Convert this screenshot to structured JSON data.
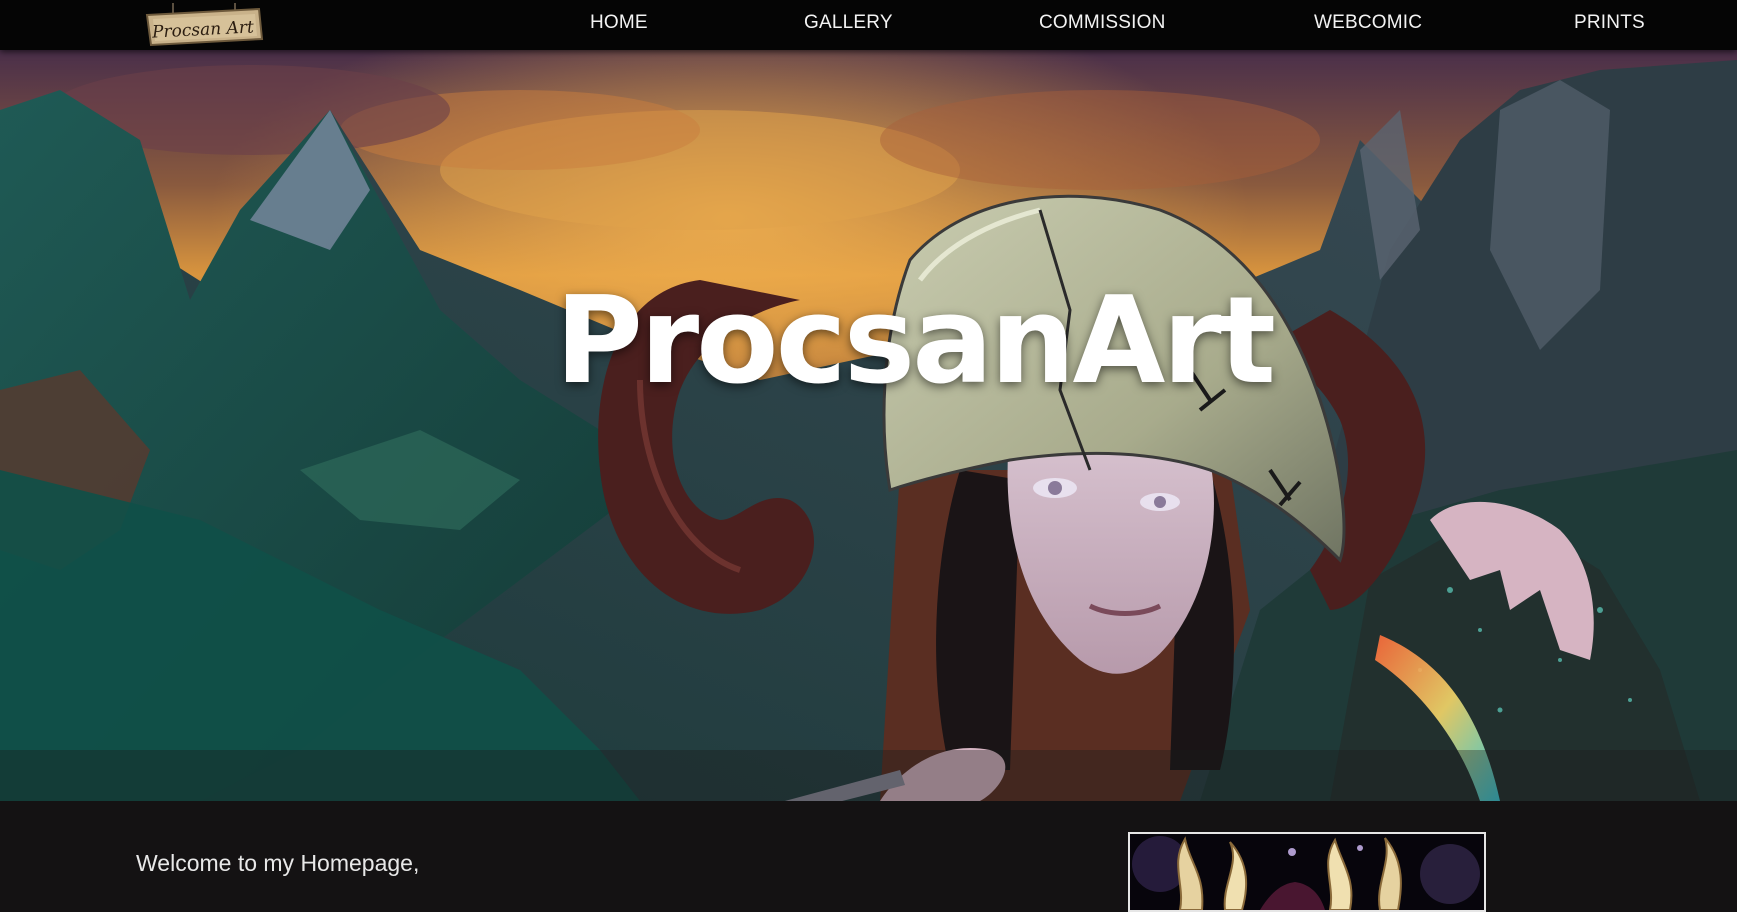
{
  "site": {
    "logo_text": "ProcsanArt",
    "logo_icon": "hanging-wooden-sign-logo"
  },
  "nav": {
    "items": [
      {
        "label": "HOME"
      },
      {
        "label": "GALLERY"
      },
      {
        "label": "COMMISSION"
      },
      {
        "label": "WEBCOMIC"
      },
      {
        "label": "PRINTS"
      }
    ]
  },
  "hero": {
    "title": "ProcsanArt",
    "image": "fantasy-warrior-woman-horned-helmet-mountains-illustration"
  },
  "main": {
    "welcome_text": "Welcome to my Homepage,",
    "feature_image": "golden-ornate-horned-crown-artwork"
  },
  "colors": {
    "nav_background": "#050505",
    "page_background": "#141213",
    "nav_text": "#f3f3f3",
    "hero_title": "#ffffff",
    "frame_border": "#e6e6e6"
  }
}
